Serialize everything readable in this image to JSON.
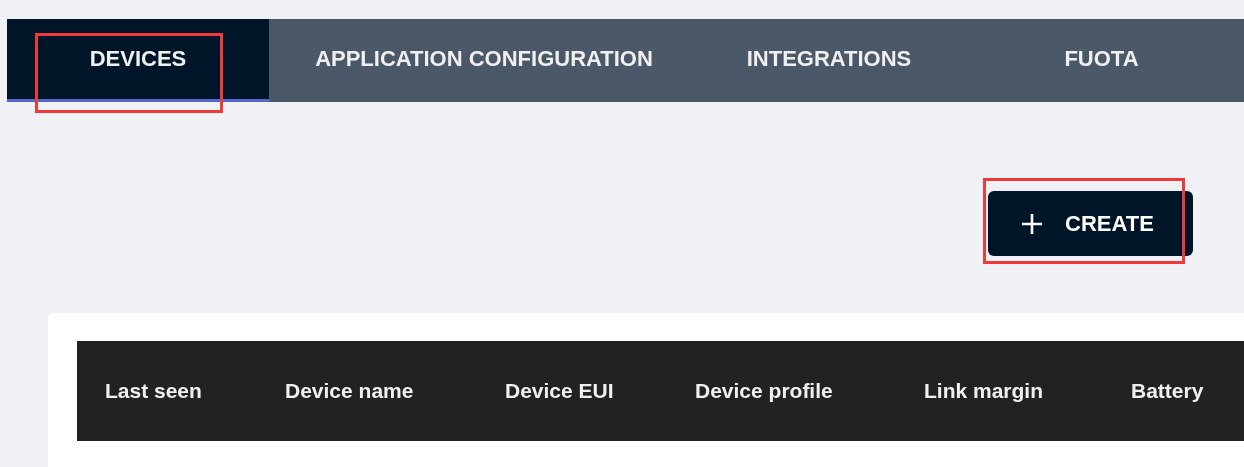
{
  "tabs": [
    {
      "label": "DEVICES",
      "selected": true,
      "highlighted": true
    },
    {
      "label": "APPLICATION CONFIGURATION",
      "selected": false,
      "highlighted": false
    },
    {
      "label": "INTEGRATIONS",
      "selected": false,
      "highlighted": false
    },
    {
      "label": "FUOTA",
      "selected": false,
      "highlighted": false
    }
  ],
  "create_button": {
    "label": "CREATE",
    "highlighted": true
  },
  "table": {
    "columns": [
      "Last seen",
      "Device name",
      "Device EUI",
      "Device profile",
      "Link margin",
      "Battery"
    ]
  }
}
